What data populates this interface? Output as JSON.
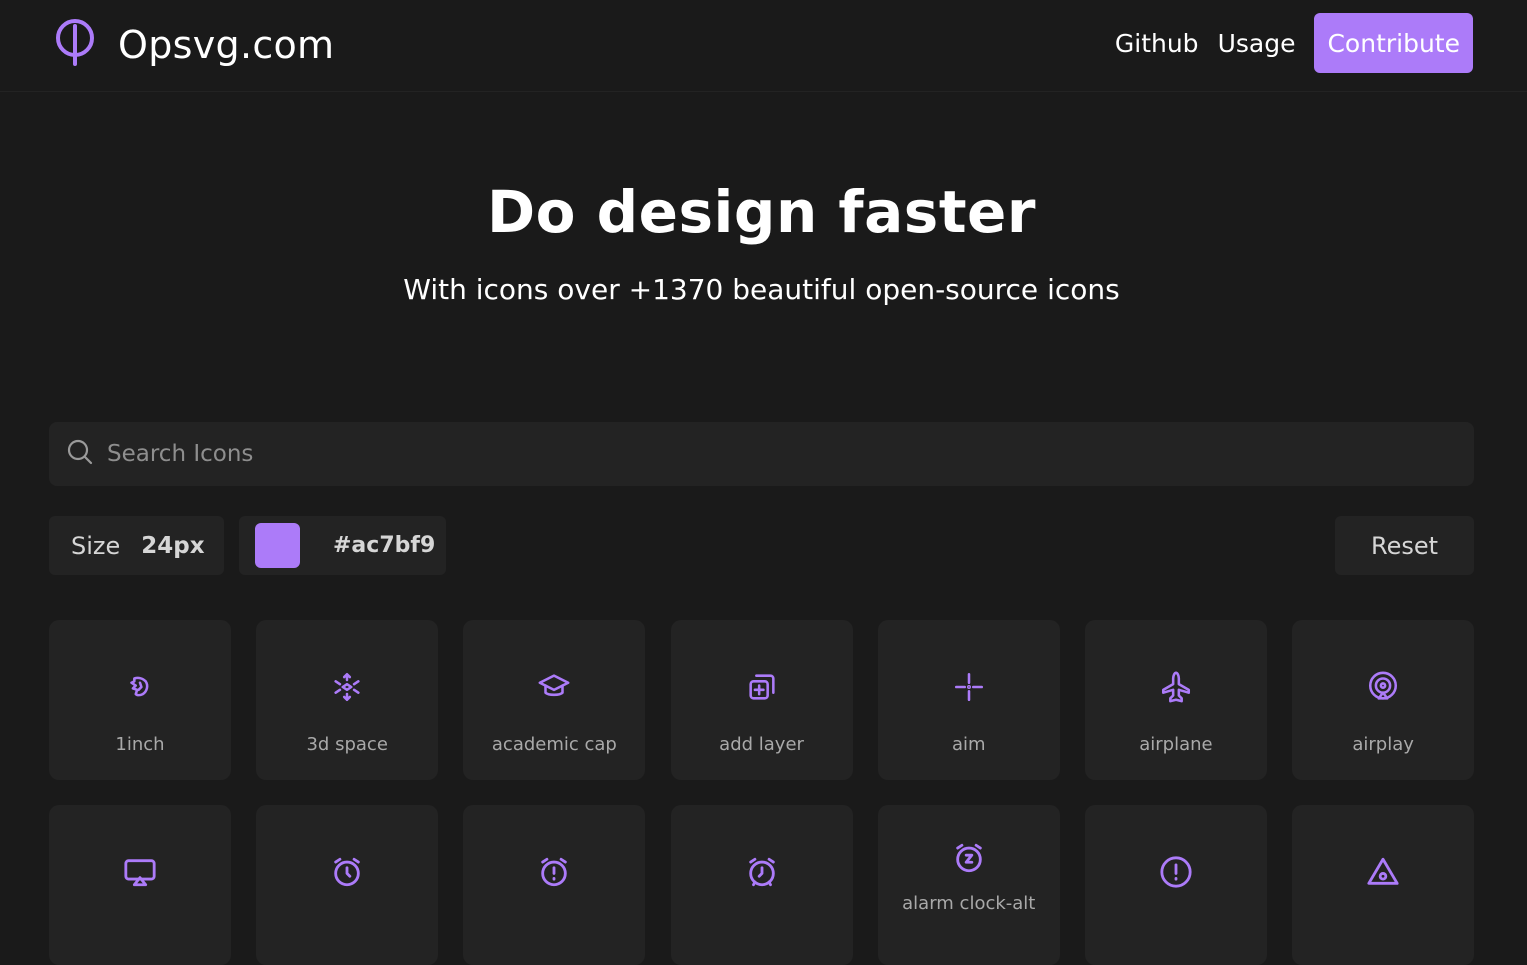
{
  "brand": {
    "name": "Opsvg.com"
  },
  "nav": {
    "github": "Github",
    "usage": "Usage",
    "contribute": "Contribute"
  },
  "hero": {
    "title": "Do design faster",
    "subtitle": "With icons over +1370 beautiful open-source icons"
  },
  "search": {
    "placeholder": "Search Icons",
    "value": ""
  },
  "controls": {
    "size_label": "Size",
    "size_value": "24px",
    "color_value": "#ac7bf9",
    "reset": "Reset"
  },
  "colors": {
    "accent": "#ac7bf9",
    "background": "#1a1a1a",
    "card": "#232323"
  },
  "icons": [
    {
      "name": "1inch",
      "icon": "1inch-icon"
    },
    {
      "name": "3d space",
      "icon": "3d-space-icon"
    },
    {
      "name": "academic cap",
      "icon": "academic-cap-icon"
    },
    {
      "name": "add layer",
      "icon": "add-layer-icon"
    },
    {
      "name": "aim",
      "icon": "aim-icon"
    },
    {
      "name": "airplane",
      "icon": "airplane-icon"
    },
    {
      "name": "airplay",
      "icon": "airplay-icon"
    },
    {
      "name": "",
      "icon": "airplay-screen-icon"
    },
    {
      "name": "",
      "icon": "alarm-clock-icon"
    },
    {
      "name": "",
      "icon": "alarm-clock-exclamation-icon"
    },
    {
      "name": "",
      "icon": "alarm-clock-check-icon"
    },
    {
      "name": "alarm clock-alt",
      "icon": "alarm-clock-alt-icon"
    },
    {
      "name": "",
      "icon": "alert-circle-icon"
    },
    {
      "name": "",
      "icon": "alert-triangle-icon"
    }
  ]
}
